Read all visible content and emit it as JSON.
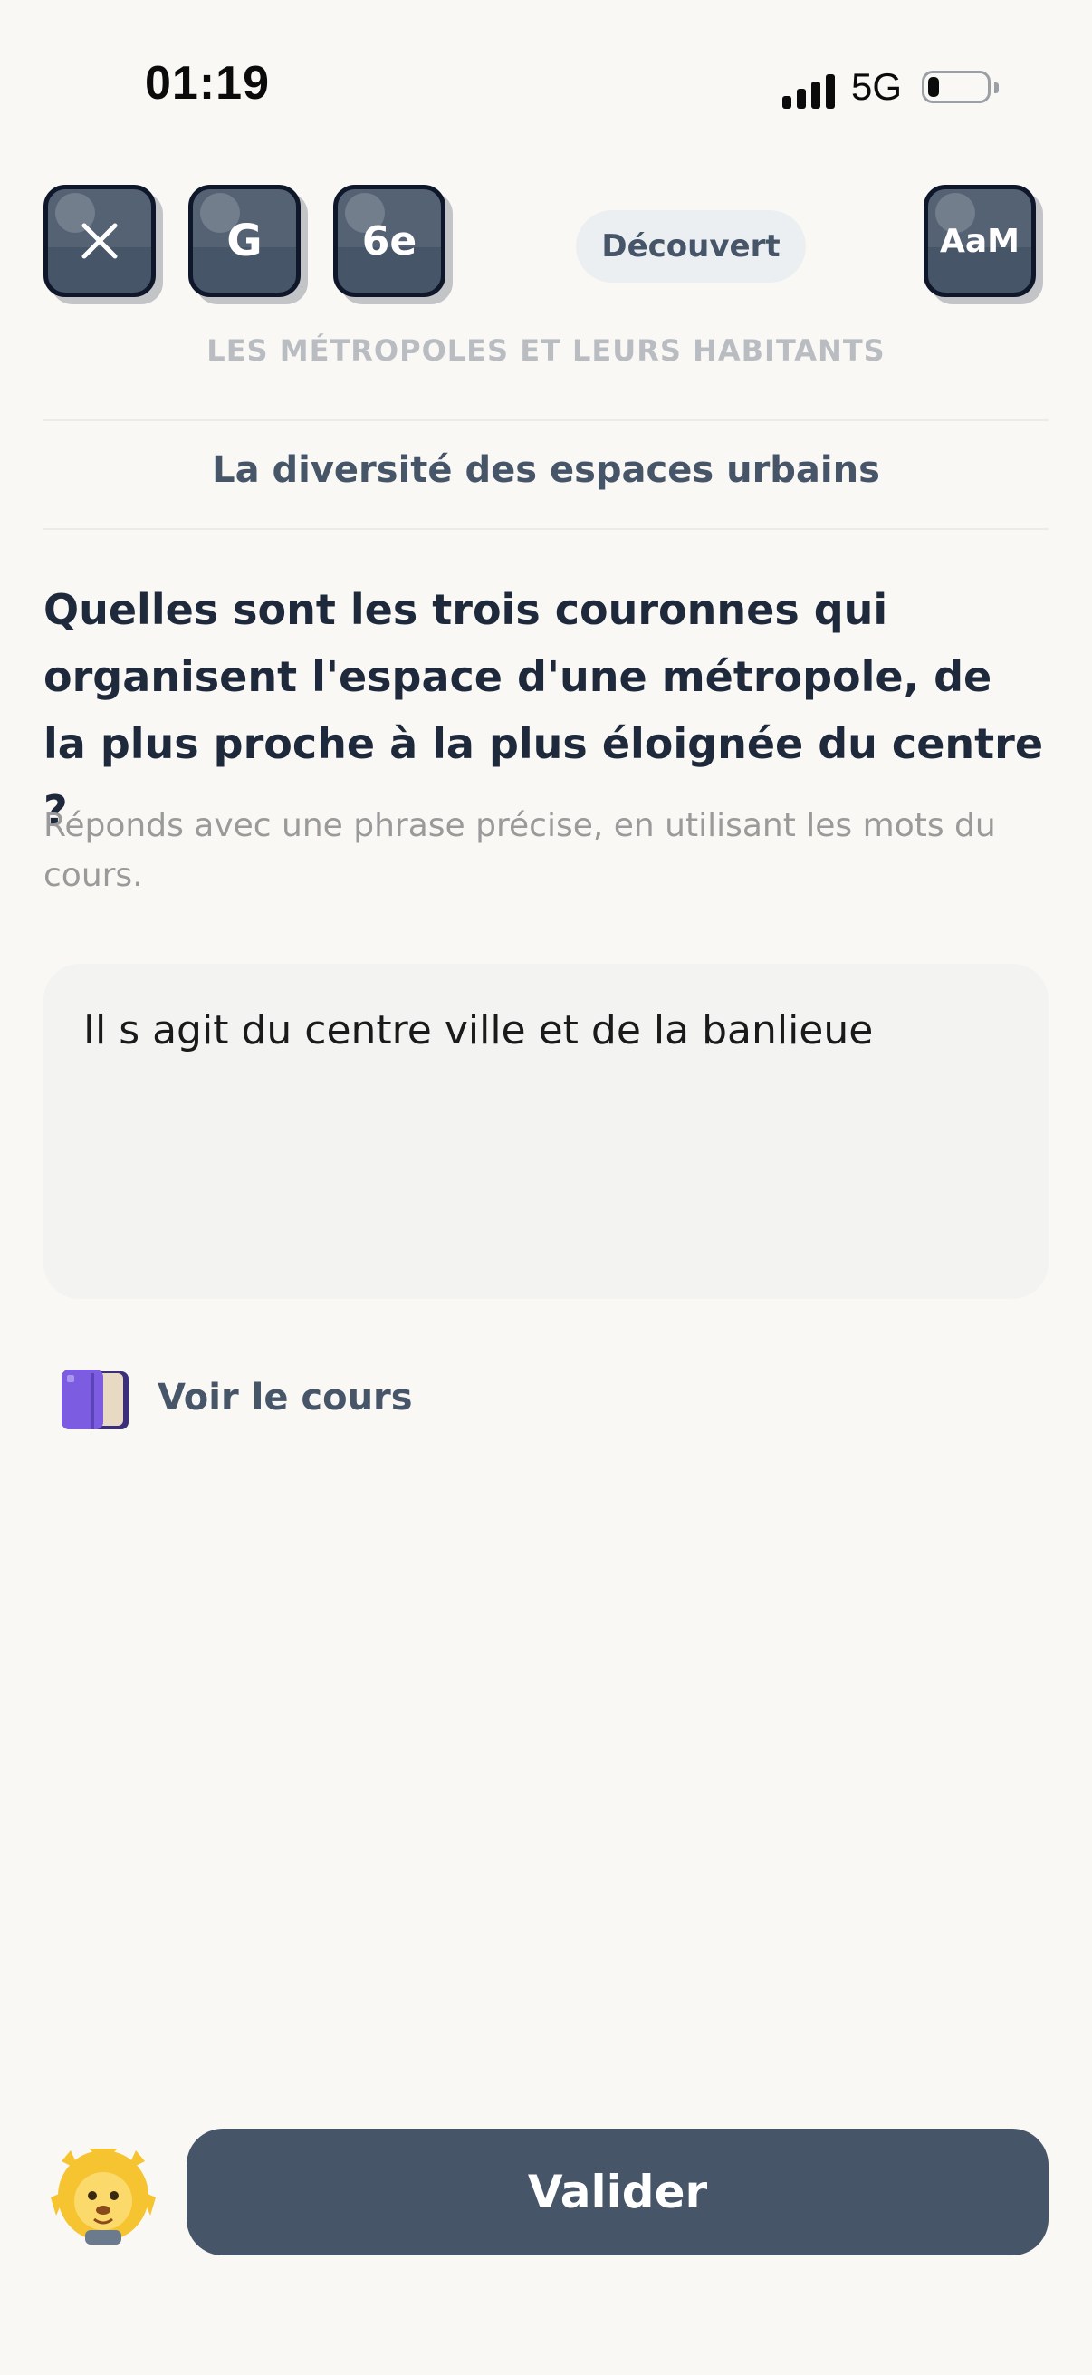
{
  "status_bar": {
    "time": "01:19",
    "network": "5G"
  },
  "header": {
    "close_icon": "close-icon",
    "subject_tile": "G",
    "level_tile": "6e",
    "status_pill": "Découvert",
    "font_tile": "AaM"
  },
  "lesson": {
    "subject": "LES MÉTROPOLES ET LEURS HABITANTS",
    "chapter": "La diversité des espaces urbains"
  },
  "question": {
    "text": "Quelles sont les trois couronnes qui organisent l'espace d'une métropole, de la plus proche à la plus éloignée du centre ?",
    "hint": "Réponds avec une phrase précise, en utilisant les mots du cours."
  },
  "answer": {
    "value": "Il s agit du centre ville et de la banlieue"
  },
  "course_link": {
    "label": "Voir le cours",
    "icon": "book-icon"
  },
  "footer": {
    "validate_label": "Valider",
    "mascot": "lion-mascot"
  },
  "colors": {
    "primary": "#475569",
    "background": "#faf8f5",
    "muted": "#9a9a9a"
  }
}
